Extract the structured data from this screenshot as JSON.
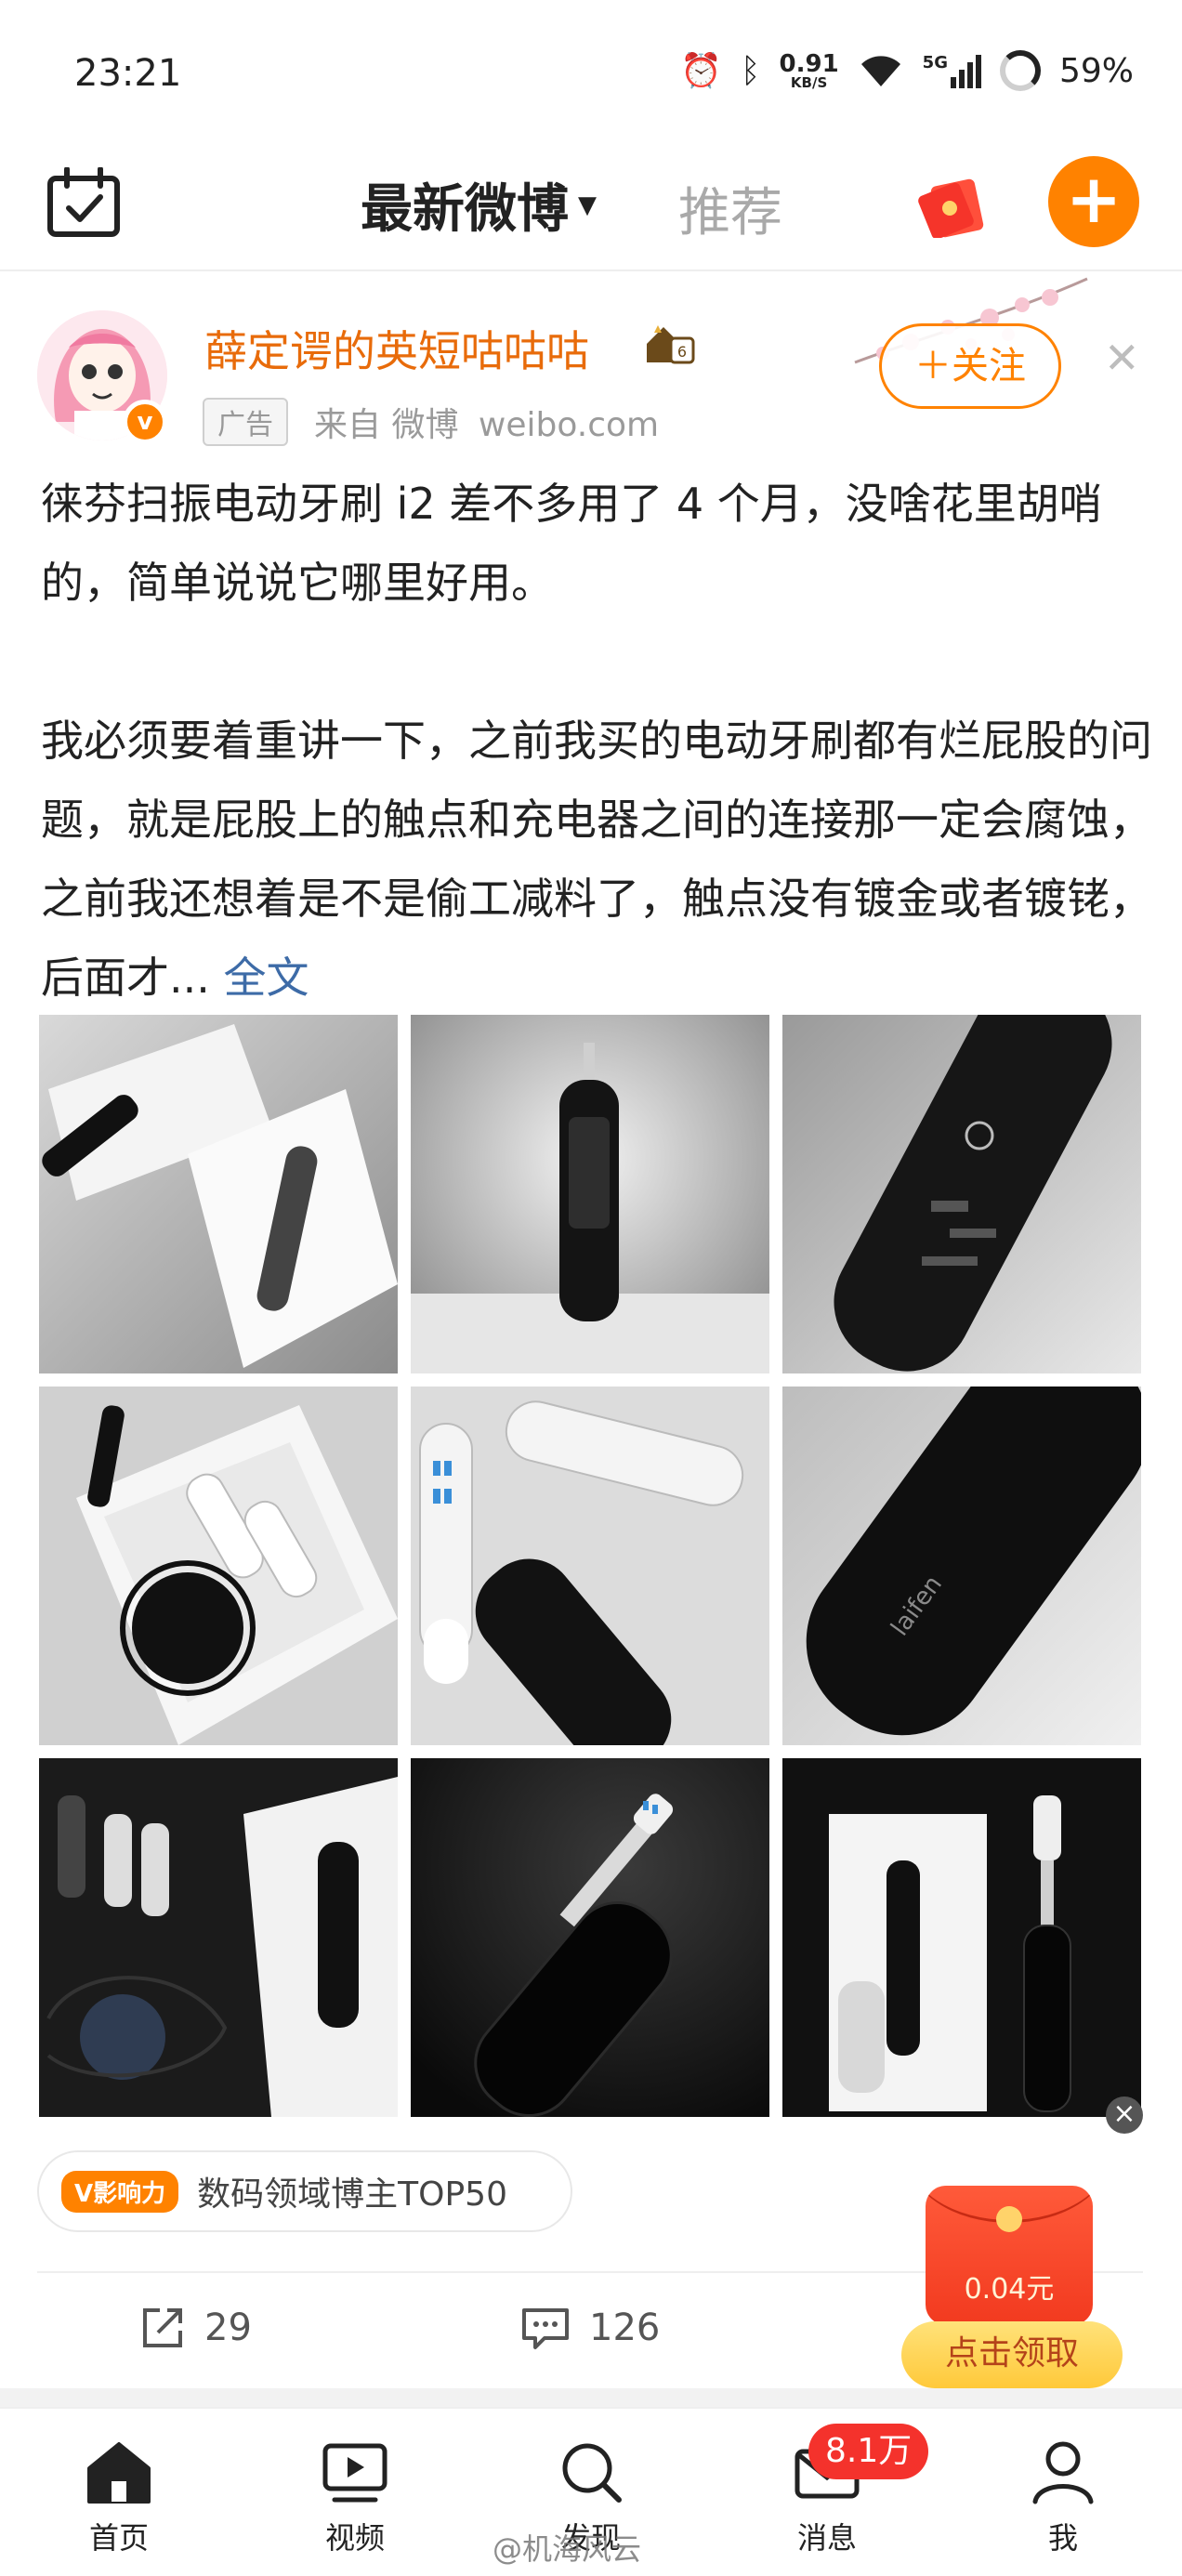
{
  "status_bar": {
    "time": "23:21",
    "net_speed": "0.91",
    "net_unit": "KB/S",
    "network": "5G",
    "battery": "59%"
  },
  "top_nav": {
    "tab_latest": "最新微博",
    "tab_recommend": "推荐",
    "accent_color": "#ff8200"
  },
  "post": {
    "author": "薛定谔的英短咕咕咕",
    "ad_tag": "广告",
    "source": "来自 微博",
    "source_domain": "weibo.com",
    "follow_label": "＋关注",
    "text_para1": "徕芬扫振电动牙刷 i2 差不多用了 4 个月，没啥花里胡哨的，简单说说它哪里好用。",
    "text_para2": "我必须要着重讲一下，之前我买的电动牙刷都有烂屁股的问题，就是屁股上的触点和充电器之间的连接那一定会腐蚀，之前我还想着是不是偷工减料了，触点没有镀金或者镀铑，后面才...",
    "full_text_link": "全文",
    "influence_badge": "V影响力",
    "influence_text": "数码领域博主TOP50",
    "share_count": "29",
    "comment_count": "126"
  },
  "photos": [
    {
      "alt": "toothbrush-box-1"
    },
    {
      "alt": "toothbrush-standing"
    },
    {
      "alt": "toothbrush-closeup"
    },
    {
      "alt": "toothbrush-kit-box"
    },
    {
      "alt": "toothbrush-heads-case"
    },
    {
      "alt": "toothbrush-logo"
    },
    {
      "alt": "toothbrush-accessories"
    },
    {
      "alt": "toothbrush-dark"
    },
    {
      "alt": "toothbrush-with-box"
    }
  ],
  "red_packet": {
    "amount": "0.04元",
    "claim_label": "点击领取"
  },
  "tab_bar": {
    "home": "首页",
    "video": "视频",
    "discover": "发现",
    "messages": "消息",
    "me": "我",
    "messages_badge": "8.1万"
  },
  "watermark": "@机海风云"
}
